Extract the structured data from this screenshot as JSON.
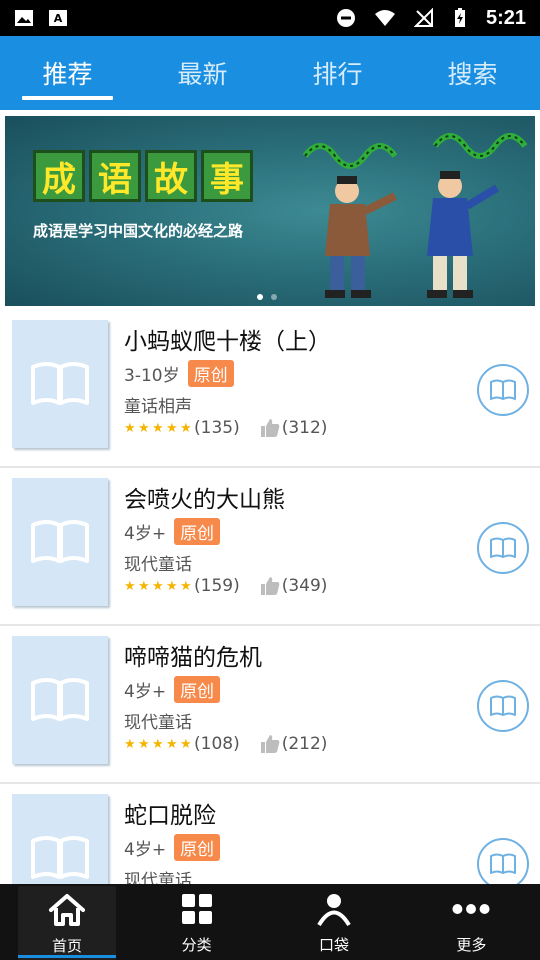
{
  "status_bar": {
    "time": "5:21",
    "icons": [
      "gallery-icon",
      "font-icon",
      "dnd-icon",
      "wifi-icon",
      "no-signal-icon",
      "battery-icon"
    ]
  },
  "top_tabs": [
    {
      "label": "推荐",
      "active": true
    },
    {
      "label": "最新",
      "active": false
    },
    {
      "label": "排行",
      "active": false
    },
    {
      "label": "搜索",
      "active": false
    }
  ],
  "banner": {
    "title_chars": [
      "成",
      "语",
      "故",
      "事"
    ],
    "subtitle": "成语是学习中国文化的必经之路",
    "colors": {
      "title_bg": "#3b9a3e",
      "title_text": "#ffe82a"
    }
  },
  "books": [
    {
      "title": "小蚂蚁爬十楼（上）",
      "age": "3-10岁",
      "badge": "原创",
      "genre": "童话相声",
      "rating": "(135)",
      "likes": "(312)"
    },
    {
      "title": "会喷火的大山熊",
      "age": "4岁+",
      "badge": "原创",
      "genre": "现代童话",
      "rating": "(159)",
      "likes": "(349)"
    },
    {
      "title": "啼啼猫的危机",
      "age": "4岁+",
      "badge": "原创",
      "genre": "现代童话",
      "rating": "(108)",
      "likes": "(212)"
    },
    {
      "title": "蛇口脱险",
      "age": "4岁+",
      "badge": "原创",
      "genre": "现代童话",
      "rating": "",
      "likes": ""
    }
  ],
  "bottom_nav": [
    {
      "label": "首页",
      "icon": "home-icon",
      "active": true
    },
    {
      "label": "分类",
      "icon": "grid-icon",
      "active": false
    },
    {
      "label": "口袋",
      "icon": "person-icon",
      "active": false
    },
    {
      "label": "更多",
      "icon": "more-icon",
      "active": false
    }
  ],
  "colors": {
    "primary": "#1a8ee0",
    "badge": "#f7894a",
    "star": "#f5b400"
  }
}
